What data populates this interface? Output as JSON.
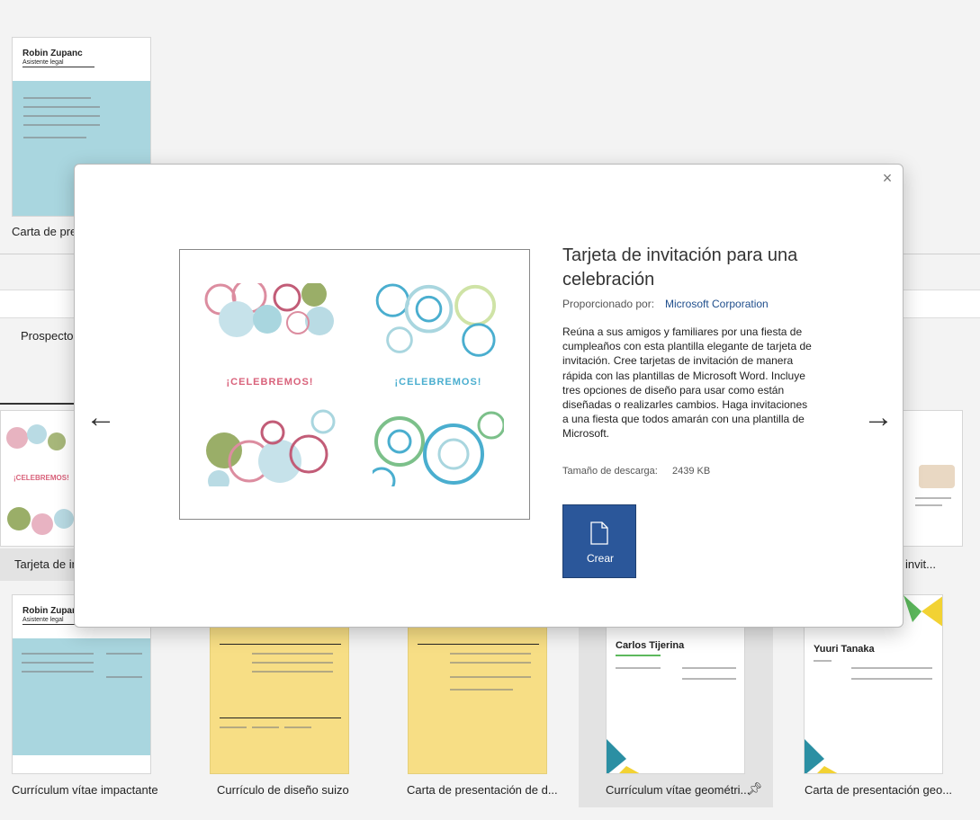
{
  "gallery": {
    "top_caption": "Carta de pres",
    "tab_partial": "Prospectos",
    "mid_left_caption": "Tarjeta de in",
    "mid_right_caption": "invit...",
    "bottom_captions": [
      "Currículum vítae impactante",
      "Currículo de diseño suizo",
      "Carta de presentación de d...",
      "Currículum vítae geométri...",
      "Carta de presentación geo..."
    ],
    "resume_name_1": "Robin Zupanc",
    "resume_role_1": "Asistente legal",
    "resume_name_2": "Robin Zupanc",
    "resume_role_2": "Asistente legal",
    "resume_name_3": "Carlos Tijerina",
    "resume_name_4": "Yuuri Tanaka",
    "celebrate_small": "¡CELEBREMOS!"
  },
  "dialog": {
    "title": "Tarjeta de invitación para una celebración",
    "provider_label": "Proporcionado por:",
    "provider_name": "Microsoft Corporation",
    "description": "Reúna a sus amigos y familiares por una fiesta de cumpleaños con esta plantilla elegante de tarjeta de invitación. Cree tarjetas de invitación de manera rápida con las plantillas de Microsoft Word. Incluye tres opciones de diseño para usar como están diseñadas o realizarles cambios. Haga invitaciones a una fiesta que todos amarán con una plantilla de Microsoft.",
    "size_label": "Tamaño de descarga:",
    "size_value": "2439 KB",
    "create_label": "Crear",
    "close_glyph": "×",
    "prev_glyph": "←",
    "next_glyph": "→",
    "card_text_left": "¡CELEBREMOS!",
    "card_text_right": "¡CELEBREMOS!"
  },
  "colors": {
    "create_button": "#2b579a",
    "celebrate_pink": "#d9627b",
    "celebrate_teal": "#4aaecf",
    "resume_blue": "#a9d6df",
    "resume_yellow": "#f7de85"
  }
}
